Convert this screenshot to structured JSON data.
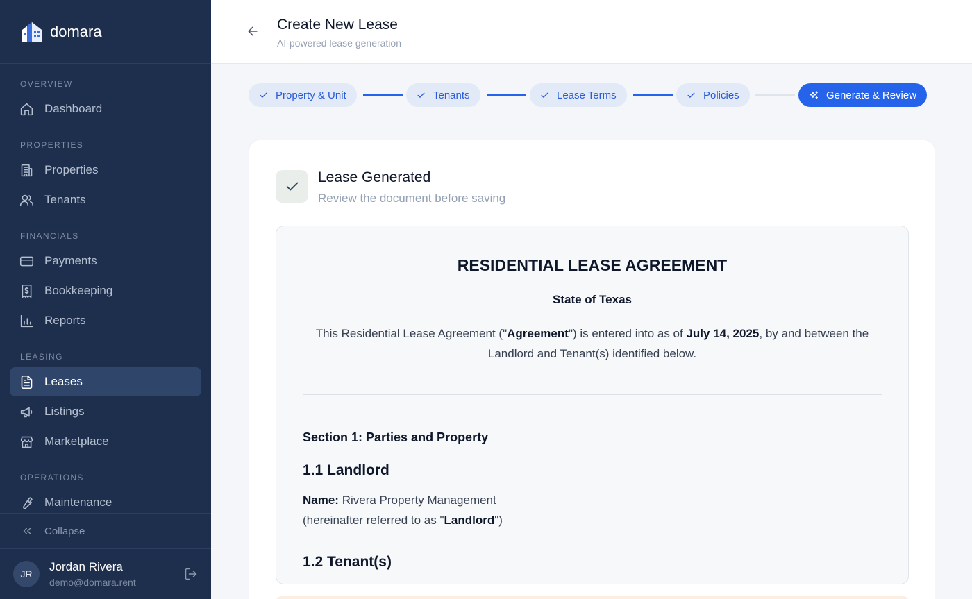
{
  "app": {
    "name": "domara"
  },
  "sidebar": {
    "sections": [
      {
        "label": "OVERVIEW",
        "items": [
          {
            "label": "Dashboard",
            "icon": "home-icon"
          }
        ]
      },
      {
        "label": "PROPERTIES",
        "items": [
          {
            "label": "Properties",
            "icon": "building-icon"
          },
          {
            "label": "Tenants",
            "icon": "users-icon"
          }
        ]
      },
      {
        "label": "FINANCIALS",
        "items": [
          {
            "label": "Payments",
            "icon": "credit-card-icon"
          },
          {
            "label": "Bookkeeping",
            "icon": "receipt-icon"
          },
          {
            "label": "Reports",
            "icon": "bar-chart-icon"
          }
        ]
      },
      {
        "label": "LEASING",
        "items": [
          {
            "label": "Leases",
            "icon": "file-text-icon",
            "active": true
          },
          {
            "label": "Listings",
            "icon": "megaphone-icon"
          },
          {
            "label": "Marketplace",
            "icon": "store-icon"
          }
        ]
      },
      {
        "label": "OPERATIONS",
        "items": [
          {
            "label": "Maintenance",
            "icon": "wrench-icon"
          }
        ]
      }
    ],
    "collapse_label": "Collapse"
  },
  "user": {
    "initials": "JR",
    "name": "Jordan Rivera",
    "email": "demo@domara.rent"
  },
  "header": {
    "title": "Create New Lease",
    "subtitle": "AI-powered lease generation"
  },
  "stepper": {
    "steps": [
      {
        "label": "Property & Unit",
        "status": "complete"
      },
      {
        "label": "Tenants",
        "status": "complete"
      },
      {
        "label": "Lease Terms",
        "status": "complete"
      },
      {
        "label": "Policies",
        "status": "complete"
      },
      {
        "label": "Generate & Review",
        "status": "current"
      }
    ]
  },
  "result": {
    "title": "Lease Generated",
    "subtitle": "Review the document before saving"
  },
  "document": {
    "title": "RESIDENTIAL LEASE AGREEMENT",
    "state": "State of Texas",
    "intro": {
      "p1": "This Residential Lease Agreement (\"",
      "agreement": "Agreement",
      "p2": "\") is entered into as of ",
      "date": "July 14, 2025",
      "p3": ", by and between the Landlord and Tenant(s) identified below."
    },
    "section1_title": "Section 1: Parties and Property",
    "landlord_heading": "1.1 Landlord",
    "landlord_name_label": "Name:",
    "landlord_name": " Rivera Property Management",
    "landlord_ref_prefix": "(hereinafter referred to as \"",
    "landlord_ref_term": "Landlord",
    "landlord_ref_suffix": "\")",
    "tenants_heading": "1.2 Tenant(s)"
  },
  "colors": {
    "sidebar_bg": "#1e2f4d",
    "accent": "#2563eb",
    "step_complete_bg": "#e2e9f7"
  }
}
